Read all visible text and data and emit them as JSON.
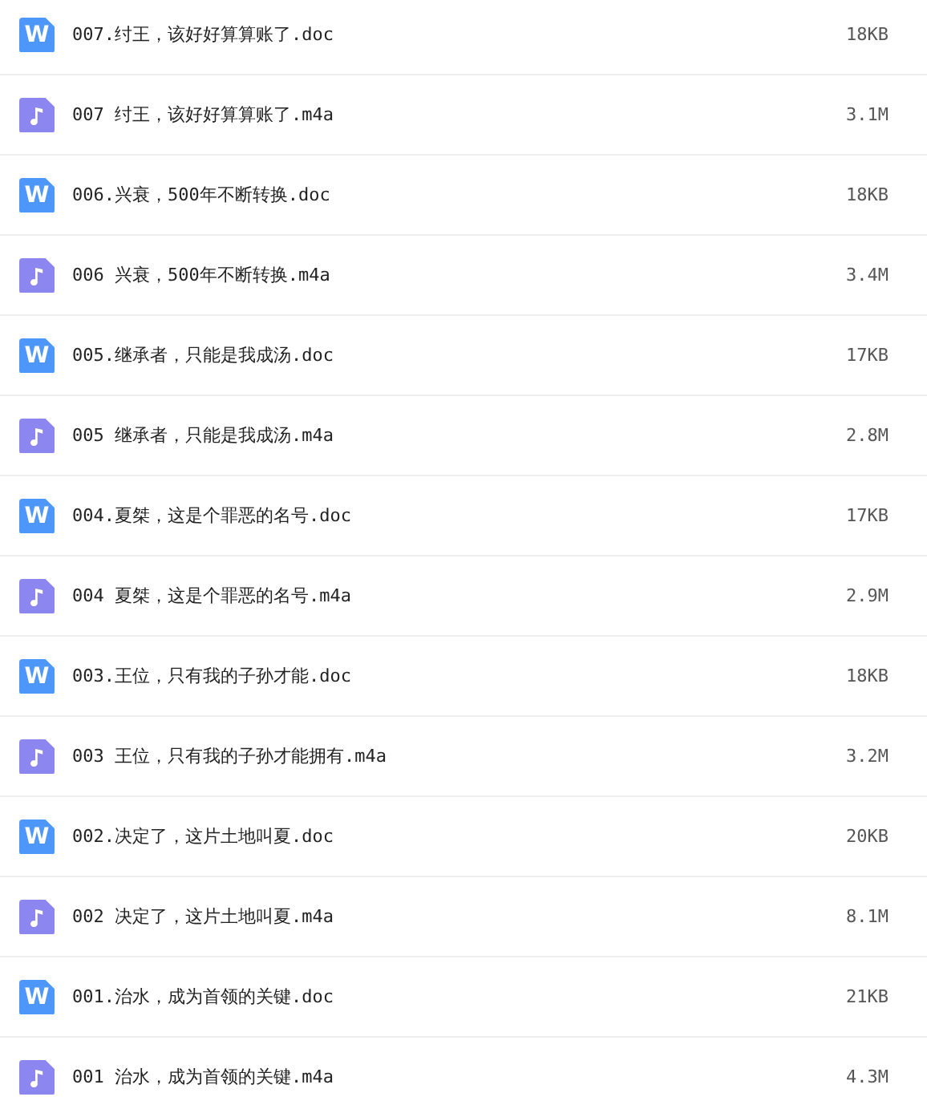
{
  "files": [
    {
      "kind": "doc",
      "badge": "W",
      "name": "007.纣王，该好好算算账了.doc",
      "size": "18KB"
    },
    {
      "kind": "audio",
      "name": "007 纣王，该好好算算账了.m4a",
      "size": "3.1M"
    },
    {
      "kind": "doc",
      "badge": "W",
      "name": "006.兴衰，500年不断转换.doc",
      "size": "18KB"
    },
    {
      "kind": "audio",
      "name": "006 兴衰，500年不断转换.m4a",
      "size": "3.4M"
    },
    {
      "kind": "doc",
      "badge": "W",
      "name": "005.继承者，只能是我成汤.doc",
      "size": "17KB"
    },
    {
      "kind": "audio",
      "name": "005 继承者，只能是我成汤.m4a",
      "size": "2.8M"
    },
    {
      "kind": "doc",
      "badge": "W",
      "name": "004.夏桀，这是个罪恶的名号.doc",
      "size": "17KB"
    },
    {
      "kind": "audio",
      "name": "004 夏桀，这是个罪恶的名号.m4a",
      "size": "2.9M"
    },
    {
      "kind": "doc",
      "badge": "W",
      "name": "003.王位，只有我的子孙才能.doc",
      "size": "18KB"
    },
    {
      "kind": "audio",
      "name": "003 王位，只有我的子孙才能拥有.m4a",
      "size": "3.2M"
    },
    {
      "kind": "doc",
      "badge": "W",
      "name": "002.决定了，这片土地叫夏.doc",
      "size": "20KB"
    },
    {
      "kind": "audio",
      "name": "002 决定了，这片土地叫夏.m4a",
      "size": "8.1M"
    },
    {
      "kind": "doc",
      "badge": "W",
      "name": "001.治水，成为首领的关键.doc",
      "size": "21KB"
    },
    {
      "kind": "audio",
      "name": "001 治水，成为首领的关键.m4a",
      "size": "4.3M"
    }
  ]
}
